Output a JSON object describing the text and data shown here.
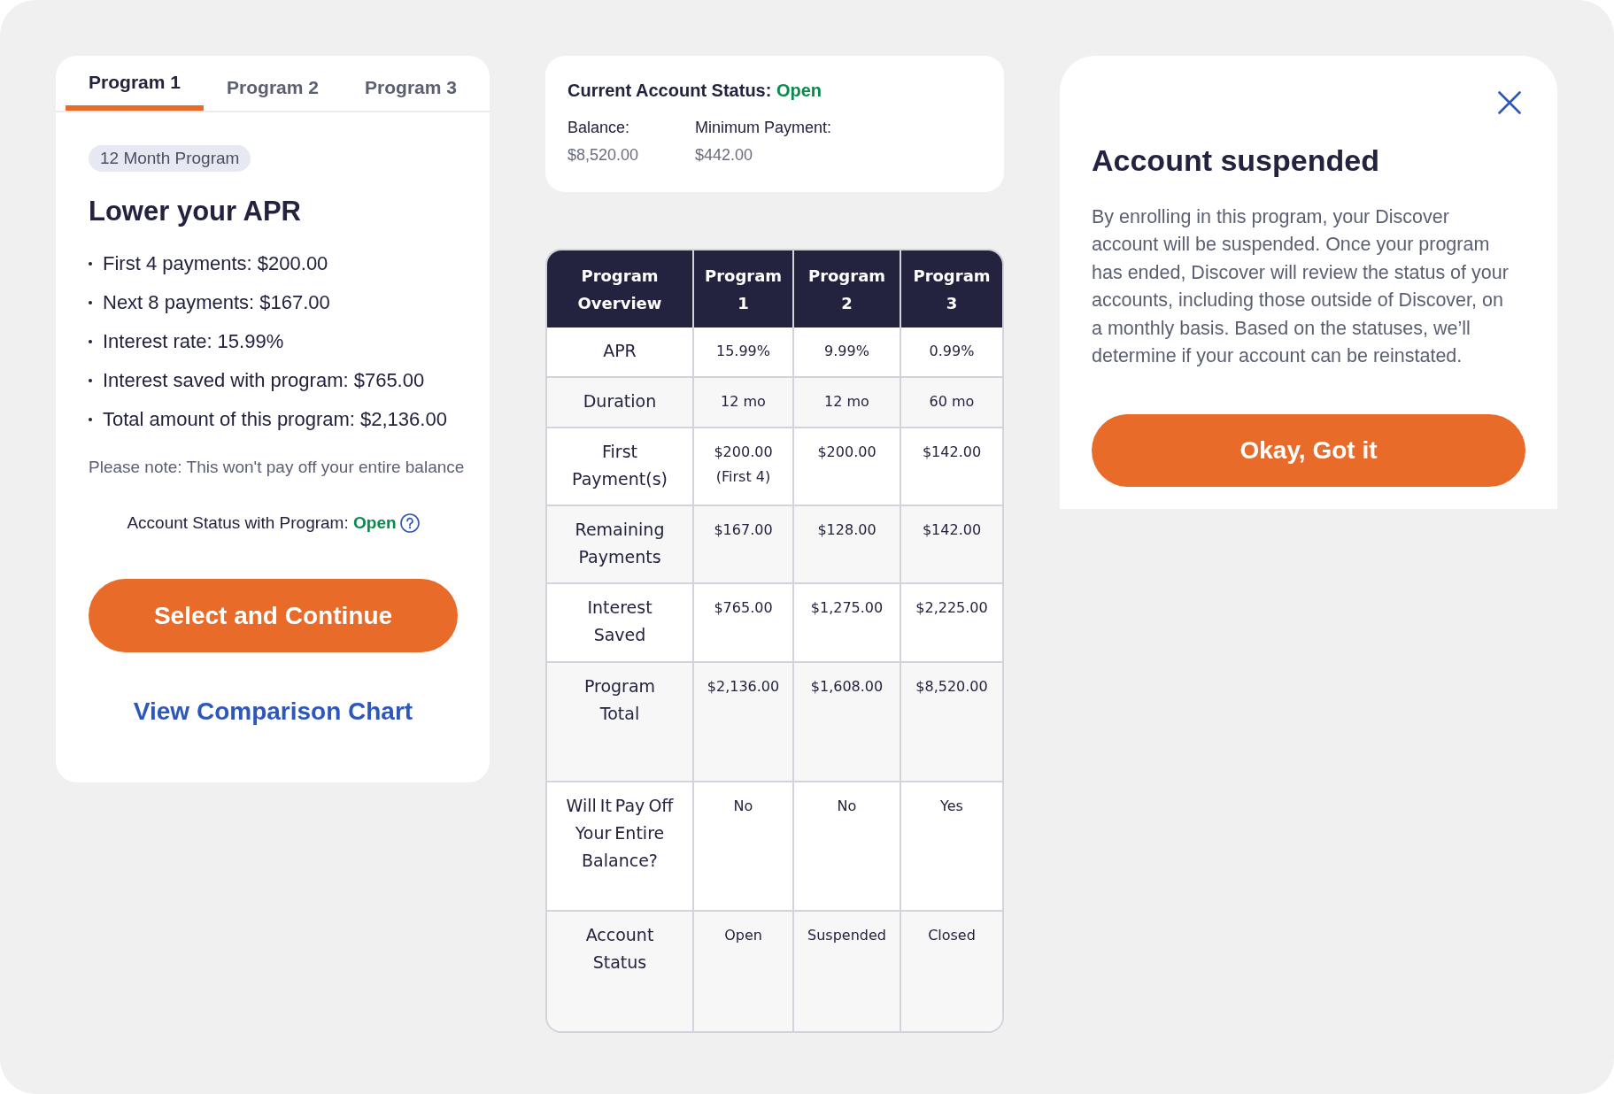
{
  "program_card": {
    "tabs": [
      {
        "label": "Program 1",
        "selected": true
      },
      {
        "label": "Program 2",
        "selected": false
      },
      {
        "label": "Program 3",
        "selected": false
      }
    ],
    "badge": "12 Month Program",
    "heading": "Lower your APR",
    "details": [
      "First 4 payments: $200.00",
      "Next 8 payments: $167.00",
      "Interest rate: 15.99%",
      "Interest saved with program: $765.00",
      "Total amount of this program: $2,136.00"
    ],
    "note": "Please note: This won't pay off your entire balance",
    "account_status": {
      "label": "Account Status with Program:",
      "value": "Open"
    },
    "primary_button": "Select and Continue",
    "comparison_link": "View Comparison Chart"
  },
  "account_summary": {
    "title": "Current Account Status:",
    "status": "Open",
    "fields": [
      {
        "label": "Balance:",
        "value": "$8,520.00"
      },
      {
        "label": "Minimum Payment:",
        "value": "$442.00"
      }
    ]
  },
  "comparison_table": {
    "columns": [
      "Program Overview",
      "Program 1",
      "Program 2",
      "Program 3"
    ],
    "rows": [
      {
        "label": "APR",
        "values": [
          "15.99%",
          "9.99%",
          "0.99%"
        ]
      },
      {
        "label": "Duration",
        "values": [
          "12 mo",
          "12 mo",
          "60 mo"
        ]
      },
      {
        "label": "First Payment(s)",
        "values": [
          "$200.00 (First 4)",
          "$200.00",
          "$142.00"
        ]
      },
      {
        "label": "Remaining Payments",
        "values": [
          "$167.00",
          "$128.00",
          "$142.00"
        ]
      },
      {
        "label": "Interest Saved",
        "values": [
          "$765.00",
          "$1,275.00",
          "$2,225.00"
        ]
      },
      {
        "label": "Program Total",
        "values": [
          "$2,136.00",
          "$1,608.00",
          "$8,520.00"
        ]
      },
      {
        "label": "Will It Pay Off Your Entire Balance?",
        "values": [
          "No",
          "No",
          "Yes"
        ]
      },
      {
        "label": "Account Status",
        "values": [
          "Open",
          "Suspended",
          "Closed"
        ]
      }
    ]
  },
  "dialog": {
    "title": "Account suspended",
    "body": "By enrolling in this program, your Discover account will be suspended. Once your program has ended, Discover will review the status of your accounts, including those outside of Discover, on a monthly basis. Based on the statuses, we’ll determine if your account can be reinstated.",
    "button": "Okay, Got it"
  }
}
